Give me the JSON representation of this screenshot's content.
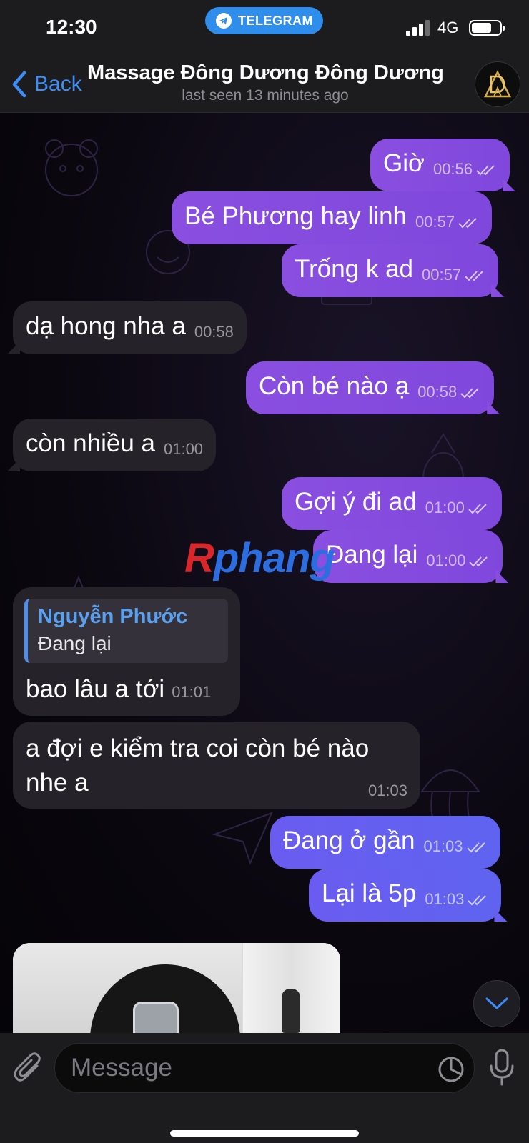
{
  "status_bar": {
    "time": "12:30",
    "app_pill": "TELEGRAM",
    "network": "4G"
  },
  "header": {
    "back_label": "Back",
    "title": "Massage Đông Dương Đông Dương",
    "status": "last seen 13 minutes ago"
  },
  "messages": [
    {
      "dir": "out",
      "text": "Giờ",
      "time": "00:56"
    },
    {
      "dir": "out",
      "text": "Bé Phương hay linh",
      "time": "00:57"
    },
    {
      "dir": "out",
      "text": "Trống k ad",
      "time": "00:57"
    },
    {
      "dir": "in",
      "text": "dạ hong nha a",
      "time": "00:58"
    },
    {
      "dir": "out",
      "text": "Còn bé nào ạ",
      "time": "00:58"
    },
    {
      "dir": "in",
      "text": "còn nhiều a",
      "time": "01:00"
    },
    {
      "dir": "out",
      "text": "Gợi ý đi ad",
      "time": "01:00"
    },
    {
      "dir": "out",
      "text": "Đang lại",
      "time": "01:00"
    },
    {
      "dir": "in",
      "reply_to_name": "Nguyễn Phước",
      "reply_to_text": "Đang lại",
      "text": "bao lâu a tới",
      "time": "01:01"
    },
    {
      "dir": "in",
      "text": "a đợi e kiểm tra coi còn bé nào nhe a",
      "time": "01:03"
    },
    {
      "dir": "out",
      "text": "Đang ở gần",
      "time": "01:03"
    },
    {
      "dir": "out",
      "text": "Lại là 5p",
      "time": "01:03"
    }
  ],
  "watermark": {
    "part1": "R",
    "part2": "phang"
  },
  "input": {
    "placeholder": "Message"
  },
  "colors": {
    "outgoing_bubble": "#8a4fe0",
    "outgoing_bubble_blue": "#6a5cf0",
    "incoming_bubble": "#262229",
    "link_blue": "#3e8cf5",
    "reply_name": "#5aa0f0"
  },
  "icons": {
    "back": "chevron-left-icon",
    "telegram": "telegram-plane-icon",
    "attach": "paperclip-icon",
    "sticker": "sticker-icon",
    "mic": "microphone-icon",
    "scroll_down": "chevron-down-icon",
    "read_receipt": "double-check-icon"
  }
}
